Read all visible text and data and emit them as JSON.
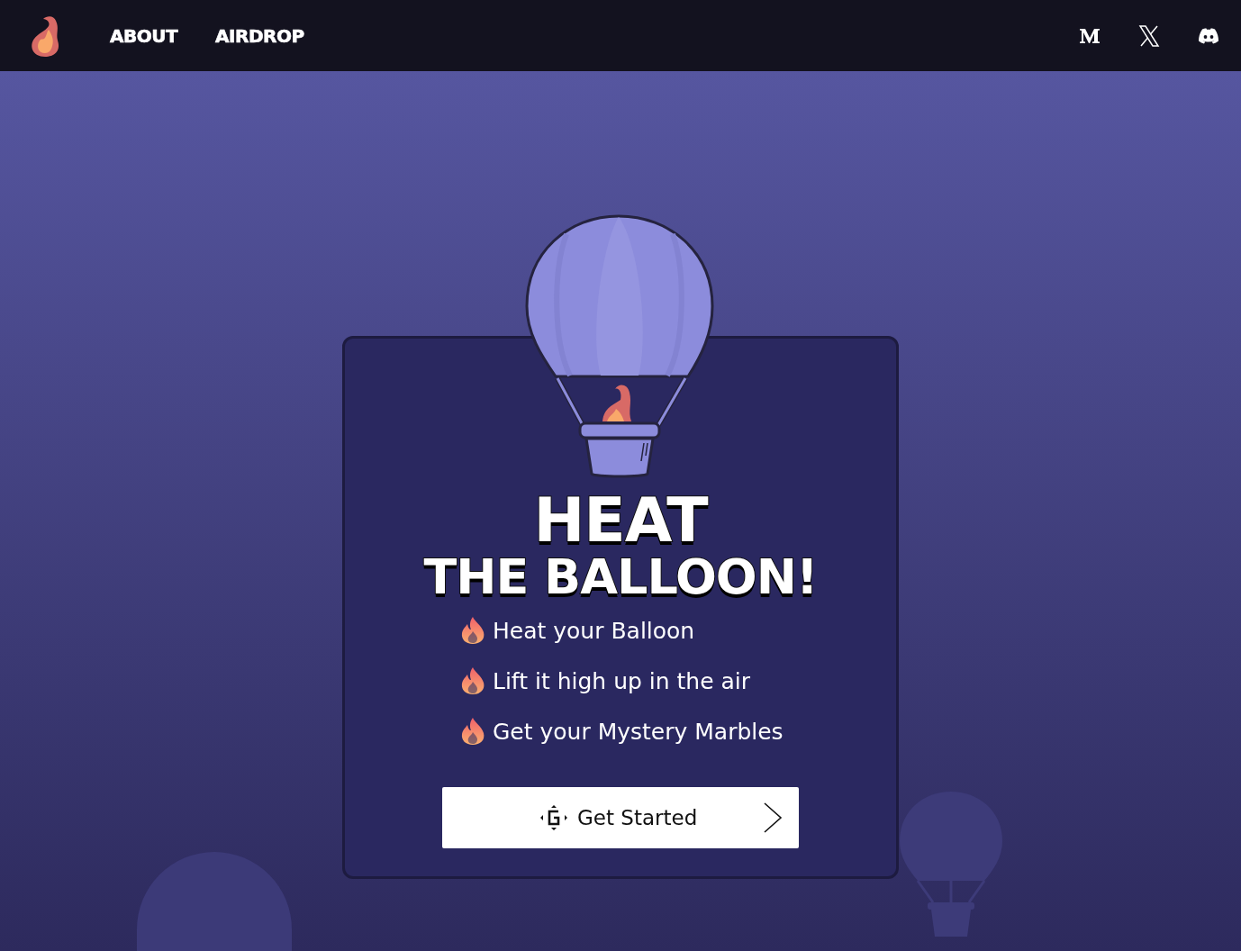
{
  "nav": {
    "links": [
      {
        "label": "ABOUT"
      },
      {
        "label": "AIRDROP"
      }
    ]
  },
  "hero": {
    "title_lines": [
      "HEAT",
      "THE BALLOON!"
    ],
    "features": [
      "Heat your Balloon",
      "Lift it high up in the air",
      "Get your Mystery Marbles"
    ],
    "button": {
      "label": "Get Started"
    }
  }
}
